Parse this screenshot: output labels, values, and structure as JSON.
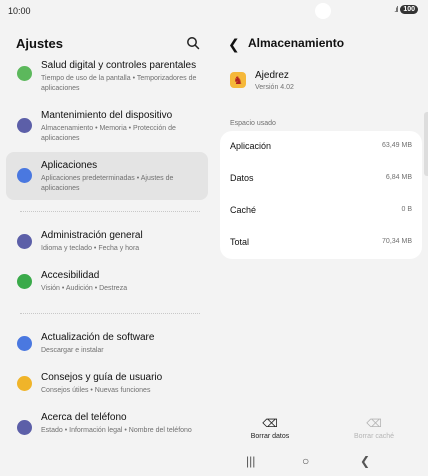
{
  "status_bar": {
    "time": "10:00",
    "battery": "100"
  },
  "left": {
    "title": "Ajustes",
    "items": [
      {
        "title": "Salud digital y controles parentales",
        "subtitle": "Tiempo de uso de la pantalla • Temporizadores de aplicaciones",
        "icon": "wellbeing-icon",
        "color": "#5cb85c",
        "selected": false
      },
      {
        "title": "Mantenimiento del dispositivo",
        "subtitle": "Almacenamiento • Memoria • Protección de aplicaciones",
        "icon": "device-care-icon",
        "color": "#5c5fa8",
        "selected": false
      },
      {
        "title": "Aplicaciones",
        "subtitle": "Aplicaciones predeterminadas • Ajustes de aplicaciones",
        "icon": "apps-icon",
        "color": "#4a78e0",
        "selected": true
      },
      {
        "title": "Administración general",
        "subtitle": "Idioma y teclado • Fecha y hora",
        "icon": "sliders-icon",
        "color": "#5c5fa8",
        "selected": false
      },
      {
        "title": "Accesibilidad",
        "subtitle": "Visión • Audición • Destreza",
        "icon": "accessibility-icon",
        "color": "#3aaa4a",
        "selected": false
      },
      {
        "title": "Actualización de software",
        "subtitle": "Descargar e instalar",
        "icon": "update-icon",
        "color": "#4a78e0",
        "selected": false
      },
      {
        "title": "Consejos y guía de usuario",
        "subtitle": "Consejos útiles • Nuevas funciones",
        "icon": "bulb-icon",
        "color": "#f0b429",
        "selected": false
      },
      {
        "title": "Acerca del teléfono",
        "subtitle": "Estado • Información legal • Nombre del teléfono",
        "icon": "info-icon",
        "color": "#5c5fa8",
        "selected": false
      }
    ]
  },
  "right": {
    "title": "Almacenamiento",
    "app_name": "Ajedrez",
    "app_version": "Versión 4.02",
    "section_label": "Espacio usado",
    "rows": [
      {
        "label": "Aplicación",
        "value": "63,49 MB"
      },
      {
        "label": "Datos",
        "value": "6,84 MB"
      },
      {
        "label": "Caché",
        "value": "0 B"
      },
      {
        "label": "Total",
        "value": "70,34 MB"
      }
    ],
    "clear_data": "Borrar datos",
    "clear_cache": "Borrar caché"
  },
  "colors": {
    "background": "#f3f3f3",
    "card": "#ffffff",
    "selected": "#e4e4e4"
  }
}
